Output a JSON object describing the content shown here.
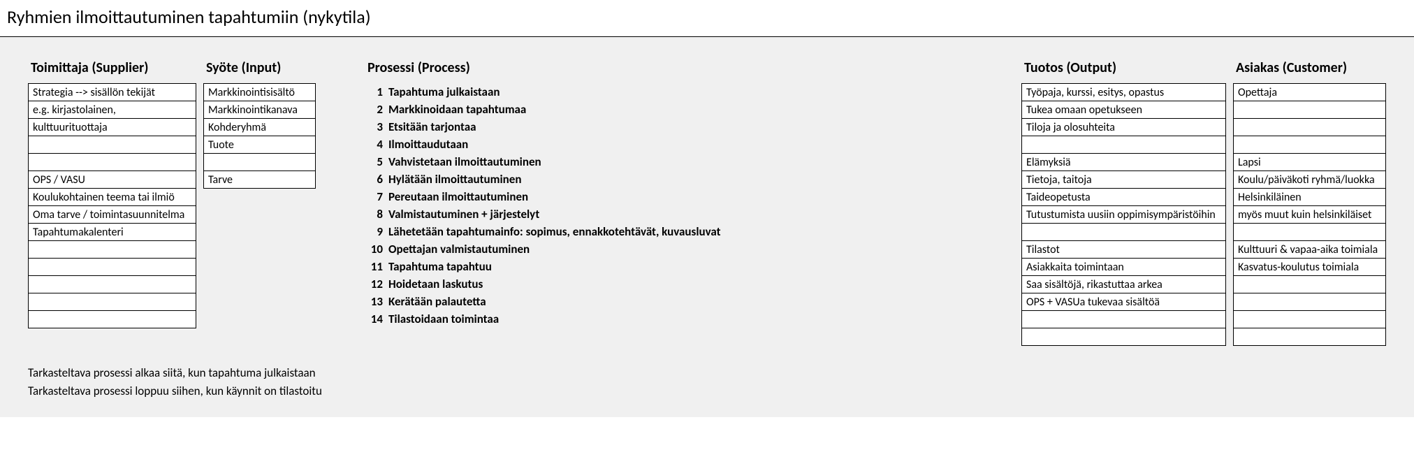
{
  "title": "Ryhmien ilmoittautuminen tapahtumiin (nykytila)",
  "headers": {
    "supplier": "Toimittaja (Supplier)",
    "input": "Syöte (Input)",
    "process": "Prosessi (Process)",
    "output": "Tuotos (Output)",
    "customer": "Asiakas (Customer)"
  },
  "supplier": [
    "Strategia --> sisällön tekijät",
    "e.g. kirjastolainen,",
    "kulttuurituottaja",
    "",
    "",
    "OPS / VASU",
    "Koulukohtainen teema tai ilmiö",
    "Oma tarve / toimintasuunnitelma",
    "Tapahtumakalenteri",
    "",
    "",
    "",
    "",
    ""
  ],
  "input": [
    "Markkinointisisältö",
    "Markkinointikanava",
    "Kohderyhmä",
    "Tuote",
    "",
    "Tarve"
  ],
  "process": [
    "Tapahtuma julkaistaan",
    "Markkinoidaan tapahtumaa",
    "Etsitään tarjontaa",
    "Ilmoittaudutaan",
    "Vahvistetaan ilmoittautuminen",
    "Hylätään ilmoittautuminen",
    "Pereutaan ilmoittautuminen",
    "Valmistautuminen + järjestelyt",
    "Lähetetään tapahtumainfo: sopimus, ennakkotehtävät, kuvausluvat",
    "Opettajan valmistautuminen",
    "Tapahtuma tapahtuu",
    "Hoidetaan laskutus",
    "Kerätään palautetta",
    "Tilastoidaan toimintaa"
  ],
  "output": [
    "Työpaja, kurssi, esitys, opastus",
    "Tukea omaan opetukseen",
    "Tiloja ja olosuhteita",
    "",
    "Elämyksiä",
    "Tietoja, taitoja",
    "Taideopetusta",
    "Tutustumista uusiin oppimisympäristöihin",
    "",
    "Tilastot",
    "Asiakkaita toimintaan",
    "Saa sisältöjä, rikastuttaa arkea",
    "OPS + VASUa tukevaa sisältöä",
    "",
    ""
  ],
  "customer": [
    "Opettaja",
    "",
    "",
    "",
    "Lapsi",
    "Koulu/päiväkoti ryhmä/luokka",
    "Helsinkiläinen",
    "myös muut kuin helsinkiläiset",
    "",
    "Kulttuuri & vapaa-aika toimiala",
    "Kasvatus-koulutus toimiala",
    "",
    "",
    "",
    ""
  ],
  "notes": [
    "Tarkasteltava prosessi alkaa siitä, kun tapahtuma julkaistaan",
    "Tarkasteltava prosessi loppuu siihen, kun käynnit on tilastoitu"
  ]
}
